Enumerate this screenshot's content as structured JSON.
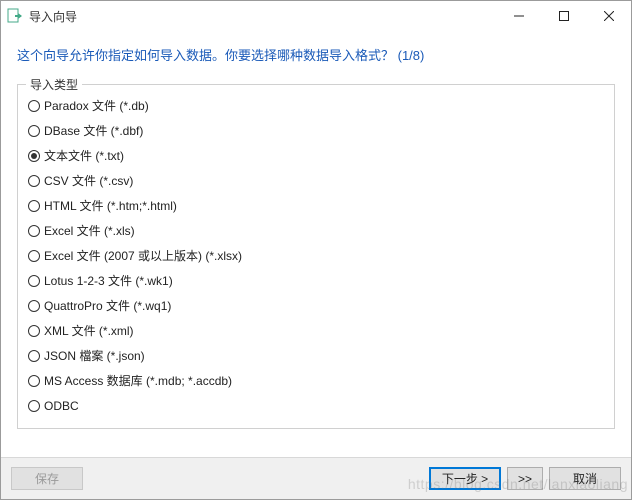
{
  "window": {
    "title": "导入向导"
  },
  "instruction": "这个向导允许你指定如何导入数据。你要选择哪种数据导入格式？ (1/8)",
  "group": {
    "legend": "导入类型",
    "selected_index": 2,
    "options": [
      "Paradox 文件 (*.db)",
      "DBase 文件 (*.dbf)",
      "文本文件 (*.txt)",
      "CSV 文件 (*.csv)",
      "HTML 文件 (*.htm;*.html)",
      "Excel 文件 (*.xls)",
      "Excel 文件 (2007 或以上版本) (*.xlsx)",
      "Lotus 1-2-3 文件 (*.wk1)",
      "QuattroPro 文件 (*.wq1)",
      "XML 文件 (*.xml)",
      "JSON 檔案 (*.json)",
      "MS Access 数据库 (*.mdb; *.accdb)",
      "ODBC"
    ]
  },
  "footer": {
    "save": "保存",
    "next": "下一步 >",
    "skip": ">>",
    "cancel": "取消"
  },
  "watermark": "https://blog.csdn.net/lanxiaoliang"
}
